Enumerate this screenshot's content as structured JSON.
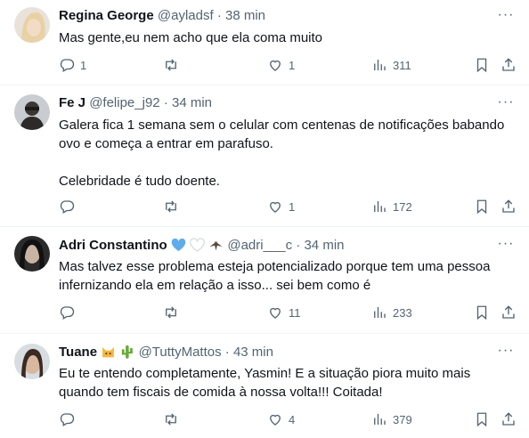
{
  "tweets": [
    {
      "name": "Regina George",
      "handle": "@ayladsf",
      "dot": "·",
      "time": "38 min",
      "text_lines": [
        "Mas gente,eu nem acho que ela coma muito"
      ],
      "replies": "1",
      "retweets": "",
      "likes": "1",
      "views": "311"
    },
    {
      "name": "Fe J",
      "handle": "@felipe_j92",
      "dot": "·",
      "time": "34 min",
      "text_lines": [
        "Galera fica 1 semana sem o celular com centenas de notificações babando",
        "ovo e começa a entrar em parafuso.",
        "",
        "Celebridade é tudo doente."
      ],
      "replies": "",
      "retweets": "",
      "likes": "1",
      "views": "172"
    },
    {
      "name": "Adri Constantino",
      "name_emojis": [
        "blue-heart",
        "white-heart",
        "eagle"
      ],
      "handle": "@adri___c",
      "dot": "·",
      "time": "34 min",
      "text_lines": [
        "Mas talvez esse problema esteja potencializado porque tem uma pessoa",
        "infernizando ela em relação a isso... sei bem como é"
      ],
      "replies": "",
      "retweets": "",
      "likes": "11",
      "views": "233"
    },
    {
      "name": "Tuane",
      "name_emojis": [
        "cat-face",
        "cactus"
      ],
      "handle": "@TuttyMattos",
      "dot": "·",
      "time": "43 min",
      "text_lines": [
        "Eu te entendo completamente, Yasmin! E a situação piora muito mais",
        "quando tem fiscais de comida à nossa volta!!! Coitada!"
      ],
      "replies": "",
      "retweets": "",
      "likes": "4",
      "views": "379"
    }
  ],
  "more_glyph": "···",
  "colors": {
    "text": "#0f1419",
    "secondary": "#536471",
    "divider": "#eff3f4",
    "heart_blue": "#5dadec"
  }
}
